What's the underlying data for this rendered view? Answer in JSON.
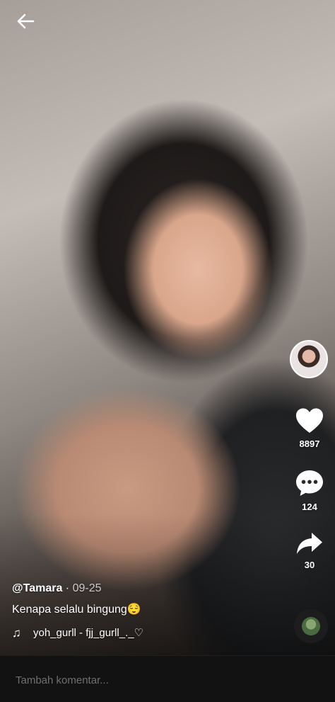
{
  "post": {
    "username": "@Tamara",
    "separator": " · ",
    "date": "09-25",
    "description": "Kenapa selalu bingung😌",
    "music": "yoh_gurll - fjj_gurll_._♡"
  },
  "actions": {
    "likes": "8897",
    "comments": "124",
    "shares": "30"
  },
  "comment_bar": {
    "placeholder": "Tambah komentar..."
  },
  "icons": {
    "back": "arrow-left-icon",
    "like": "heart-icon",
    "comment": "speech-bubble-icon",
    "share": "share-arrow-icon",
    "music": "music-note-icon"
  },
  "colors": {
    "text": "#ffffff",
    "comment_bar_bg": "#121212",
    "placeholder": "#6f6f6f"
  }
}
